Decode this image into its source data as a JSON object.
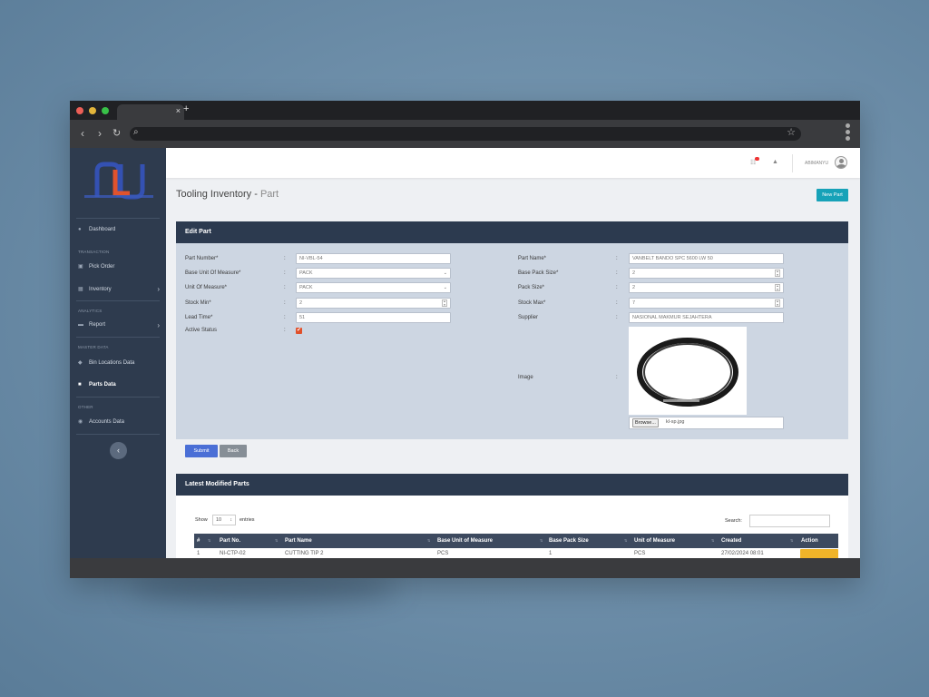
{
  "browser": {
    "new_tab": "+",
    "tab_close": "×"
  },
  "topbar": {
    "username": "ABIMANYU"
  },
  "sidebar": {
    "items": [
      {
        "label": "Dashboard",
        "icon": "dashboard-icon"
      },
      {
        "section": "TRANSACTION"
      },
      {
        "label": "Pick Order",
        "icon": "basket-icon"
      },
      {
        "label": "Inventory",
        "icon": "boxes-icon"
      },
      {
        "section": "ANALYTICS"
      },
      {
        "label": "Report",
        "icon": "folder-icon"
      },
      {
        "section": "MASTER DATA"
      },
      {
        "label": "Bin Locations Data",
        "icon": "tag-icon"
      },
      {
        "label": "Parts Data",
        "icon": "parts-icon"
      },
      {
        "section": "OTHER"
      },
      {
        "label": "Accounts Data",
        "icon": "users-icon"
      }
    ]
  },
  "page": {
    "title": "Tooling Inventory - ",
    "subtitle": "Part",
    "new_button": "New Part"
  },
  "edit_card": {
    "title": "Edit Part",
    "left_fields": [
      {
        "label": "Part Number*",
        "value": "NI-VBL-54"
      },
      {
        "label": "Base Unit Of Measure*",
        "value": "PACK"
      },
      {
        "label": "Unit Of Measure*",
        "value": "PACK"
      },
      {
        "label": "Stock Min*",
        "value": "2"
      },
      {
        "label": "Lead Time*",
        "value": "51"
      },
      {
        "label": "Active Status",
        "value": "✔"
      }
    ],
    "right_fields": [
      {
        "label": "Part Name*",
        "value": "VANBELT BANDO SPC 5600 LW 50"
      },
      {
        "label": "Base Pack Size*",
        "value": "2"
      },
      {
        "label": "Pack Size*",
        "value": "2"
      },
      {
        "label": "Stock Max*",
        "value": "7"
      },
      {
        "label": "Supplier",
        "value": "NASIONAL MAKMUR SEJAHTERA"
      },
      {
        "label": "Image",
        "value": ""
      }
    ],
    "colon": ":",
    "file_button": "Browse...",
    "file_name": "kl-sp.jpg",
    "submit": "Submit",
    "back": "Back"
  },
  "latest_card": {
    "title": "Latest Modified Parts",
    "show_label": "Show",
    "entries_value": "10",
    "entries_label": "entries",
    "search_label": "Search:",
    "columns": [
      "#",
      "Part No.",
      "Part Name",
      "Base Unit of Measure",
      "Base Pack Size",
      "Unit of Measure",
      "Created",
      "Action"
    ],
    "rows": [
      [
        "1",
        "NI-CTP-02",
        "CUTTING TIP 2",
        "PCS",
        "1",
        "PCS",
        "27/02/2024 08:01"
      ]
    ]
  },
  "colors": {
    "sidebar": "#2e3b4e",
    "accent": "#17a2b8",
    "submit": "#4a6fd6",
    "edit": "#f0b429",
    "card_header": "#2c3a4f"
  }
}
